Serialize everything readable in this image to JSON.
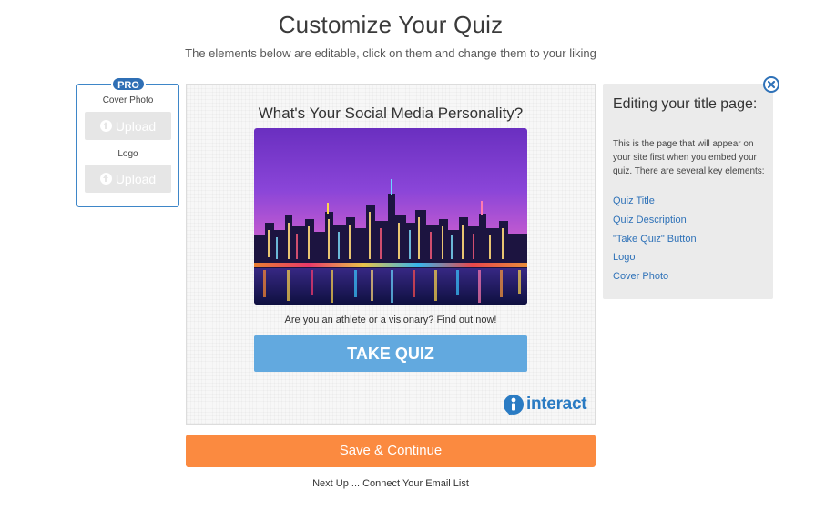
{
  "header": {
    "title": "Customize Your Quiz",
    "subtitle": "The elements below are editable, click on them and change them to your liking"
  },
  "left_panel": {
    "badge": "PRO",
    "cover_photo_label": "Cover Photo",
    "cover_upload_label": "Upload",
    "logo_label": "Logo",
    "logo_upload_label": "Upload"
  },
  "preview": {
    "quiz_title": "What's Your Social Media Personality?",
    "cover_photo": "city-skyline-night-image",
    "description": "Are you an athlete or a visionary? Find out now!",
    "take_quiz_label": "TAKE QUIZ",
    "logo_text": "interact"
  },
  "help_panel": {
    "heading": "Editing your title page:",
    "body": "This is the page that will appear on your site first when you embed your quiz. There are several key elements:",
    "links": [
      "Quiz Title",
      "Quiz Description",
      "\"Take Quiz\" Button",
      "Logo",
      "Cover Photo"
    ]
  },
  "footer": {
    "save_label": "Save & Continue",
    "next_up": "Next Up ... Connect Your Email List"
  },
  "colors": {
    "accent_blue": "#3e86c8",
    "take_quiz_blue": "#62a9df",
    "save_orange": "#fb8a40",
    "link_blue": "#2f72b8"
  }
}
